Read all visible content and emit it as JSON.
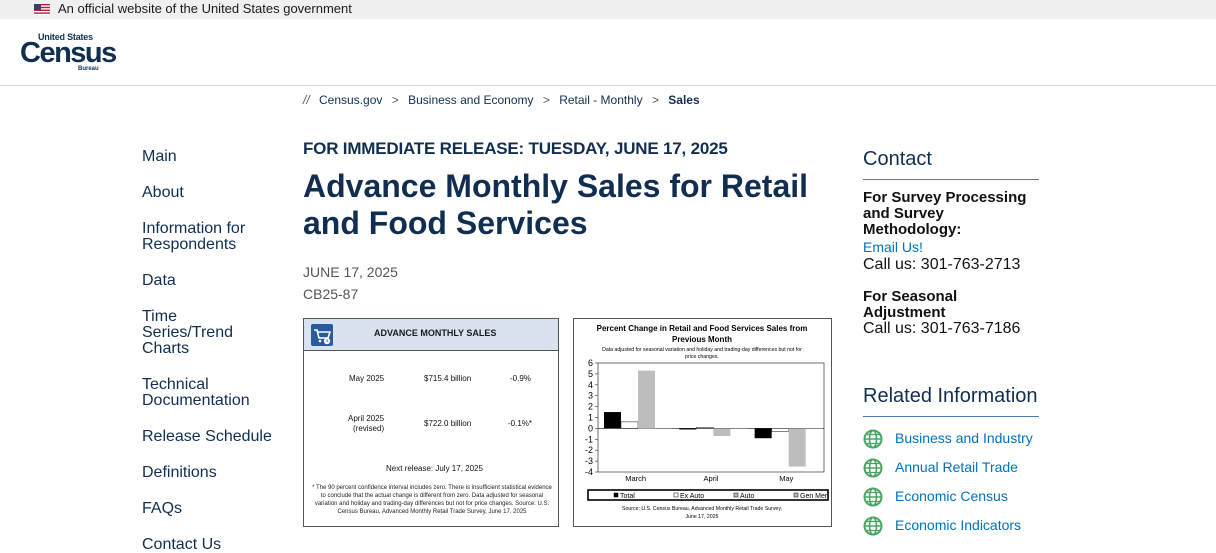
{
  "gov_banner": {
    "text": "An official website of the United States government"
  },
  "logo": {
    "line1": "United States",
    "line2": "Census",
    "line3": "Bureau"
  },
  "breadcrumb": {
    "lead": "//",
    "items": [
      "Census.gov",
      "Business and Economy",
      "Retail - Monthly"
    ],
    "current": "Sales",
    "separator": ">"
  },
  "left_nav": [
    "Main",
    "About",
    "Information for Respondents",
    "Data",
    "Time Series/Trend Charts",
    "Technical Documentation",
    "Release Schedule",
    "Definitions",
    "FAQs",
    "Contact Us"
  ],
  "main": {
    "release": "FOR IMMEDIATE RELEASE: TUESDAY, JUNE 17, 2025",
    "title": "Advance Monthly Sales for Retail and Food Services",
    "date": "JUNE 17, 2025",
    "code": "CB25-87"
  },
  "sales_box": {
    "title": "ADVANCE MONTHLY SALES",
    "rows": [
      {
        "period": "May 2025",
        "value": "$715.4 billion",
        "change": "-0.9%"
      },
      {
        "period": "April 2025",
        "period_note": "(revised)",
        "value": "$722.0 billion",
        "change": "-0.1%*"
      }
    ],
    "next_release": "Next release: July 17, 2025",
    "footnote": "* The 90 percent confidence interval includes zero. There is insufficient statistical evidence to conclude that the actual change is different from zero. Data adjusted for seasonal variation and holiday and trading-day differences but not for price changes. Source: U.S. Census Bureau, Advanced Monthly Retail Trade Survey, June 17, 2025"
  },
  "chart_data": {
    "type": "bar",
    "title": "Percent Change in Retail and Food Services Sales from Previous Month",
    "subtitle": "Data adjusted for seasonal variation and holiday and trading-day differences but not for price changes.",
    "categories": [
      "March",
      "April",
      "May"
    ],
    "series": [
      {
        "name": "Total",
        "color": "#000000",
        "values": [
          1.5,
          -0.1,
          -0.9
        ]
      },
      {
        "name": "Ex Auto",
        "color": "#ffffff",
        "values": [
          0.6,
          0.1,
          -0.3
        ]
      },
      {
        "name": "Auto",
        "color": "#bdbdbd",
        "values": [
          5.3,
          -0.7,
          -3.5
        ]
      },
      {
        "name": "Gen Mer",
        "color": "#bdbdbd",
        "values": [
          0,
          0,
          0
        ]
      }
    ],
    "yticks": [
      6,
      5,
      4,
      3,
      2,
      1,
      0,
      -1,
      -2,
      -3,
      -4
    ],
    "ylim": [
      -4,
      6
    ],
    "legend": "bottom",
    "source": "Source: U.S. Census Bureau, Advanced Monthly Retail Trade Survey, June 17, 2025"
  },
  "contact": {
    "heading": "Contact",
    "survey_label": "For Survey Processing and Survey Methodology:",
    "email": "Email Us!",
    "phone1": "Call us: 301-763-2713",
    "seasonal_label": "For Seasonal Adjustment",
    "phone2": "Call us: 301-763-7186"
  },
  "related": {
    "heading": "Related Information",
    "items": [
      "Business and Industry",
      "Annual Retail Trade",
      "Economic Census",
      "Economic Indicators"
    ]
  },
  "colors": {
    "navy": "#112e51",
    "link": "#0071bc",
    "globe": "#4aa564"
  }
}
